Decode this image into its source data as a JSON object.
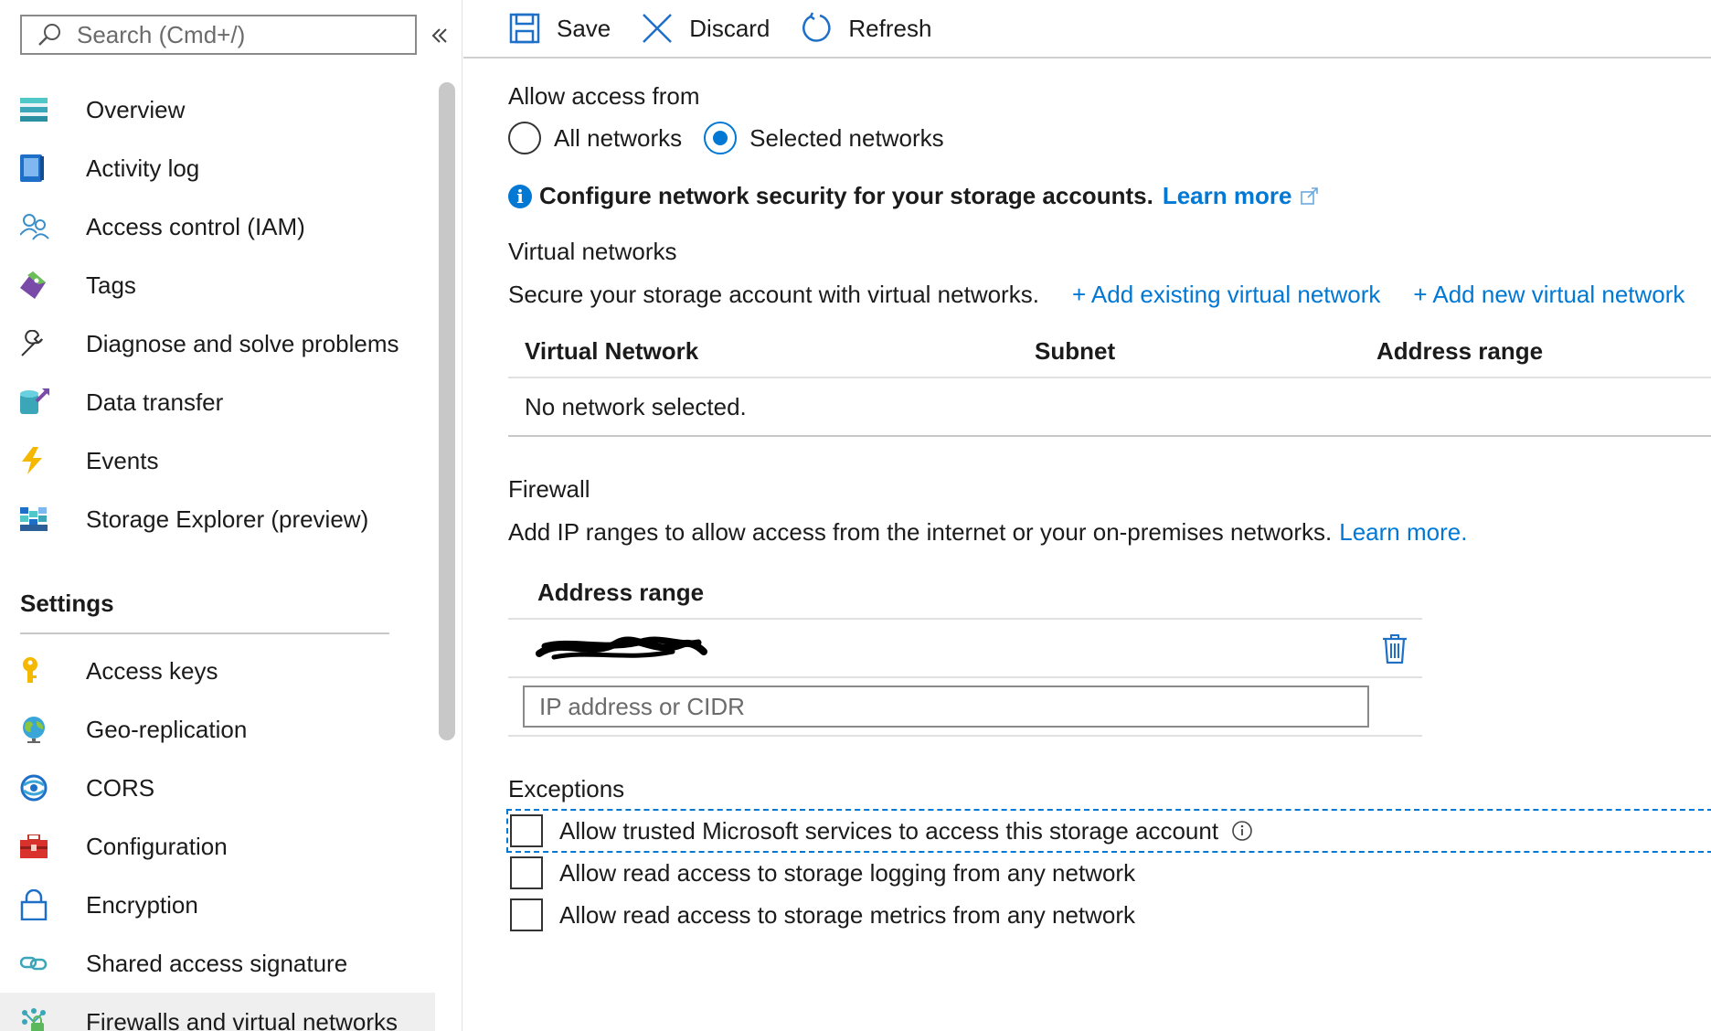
{
  "sidebar": {
    "search": {
      "placeholder": "Search (Cmd+/)"
    },
    "items": [
      {
        "label": "Overview",
        "icon": "overview-icon"
      },
      {
        "label": "Activity log",
        "icon": "activity-log-icon"
      },
      {
        "label": "Access control (IAM)",
        "icon": "users-icon"
      },
      {
        "label": "Tags",
        "icon": "tag-icon"
      },
      {
        "label": "Diagnose and solve problems",
        "icon": "wrench-icon"
      },
      {
        "label": "Data transfer",
        "icon": "data-transfer-icon"
      },
      {
        "label": "Events",
        "icon": "lightning-icon"
      },
      {
        "label": "Storage Explorer (preview)",
        "icon": "storage-explorer-icon"
      }
    ],
    "settings_heading": "Settings",
    "settings_items": [
      {
        "label": "Access keys",
        "icon": "key-icon"
      },
      {
        "label": "Geo-replication",
        "icon": "globe-icon"
      },
      {
        "label": "CORS",
        "icon": "cors-icon"
      },
      {
        "label": "Configuration",
        "icon": "toolbox-icon"
      },
      {
        "label": "Encryption",
        "icon": "lock-icon"
      },
      {
        "label": "Shared access signature",
        "icon": "link-icon"
      },
      {
        "label": "Firewalls and virtual networks",
        "icon": "firewall-icon",
        "active": true
      }
    ]
  },
  "toolbar": {
    "save": "Save",
    "discard": "Discard",
    "refresh": "Refresh"
  },
  "access": {
    "label": "Allow access from",
    "options": [
      "All networks",
      "Selected networks"
    ],
    "selected": "Selected networks"
  },
  "info": {
    "text": "Configure network security for your storage accounts.",
    "link": "Learn more"
  },
  "vnet": {
    "title": "Virtual networks",
    "description": "Secure your storage account with virtual networks.",
    "add_existing": "+ Add existing virtual network",
    "add_new": "+ Add new virtual network",
    "columns": [
      "Virtual Network",
      "Subnet",
      "Address range"
    ],
    "empty": "No network selected."
  },
  "firewall": {
    "title": "Firewall",
    "description": "Add IP ranges to allow access from the internet or your on-premises networks.",
    "link": "Learn more.",
    "column": "Address range",
    "input_placeholder": "IP address or CIDR"
  },
  "exceptions": {
    "title": "Exceptions",
    "items": [
      "Allow trusted Microsoft services to access this storage account",
      "Allow read access to storage logging from any network",
      "Allow read access to storage metrics from any network"
    ]
  },
  "colors": {
    "accent": "#0078d4",
    "active_bg": "#efefef"
  }
}
